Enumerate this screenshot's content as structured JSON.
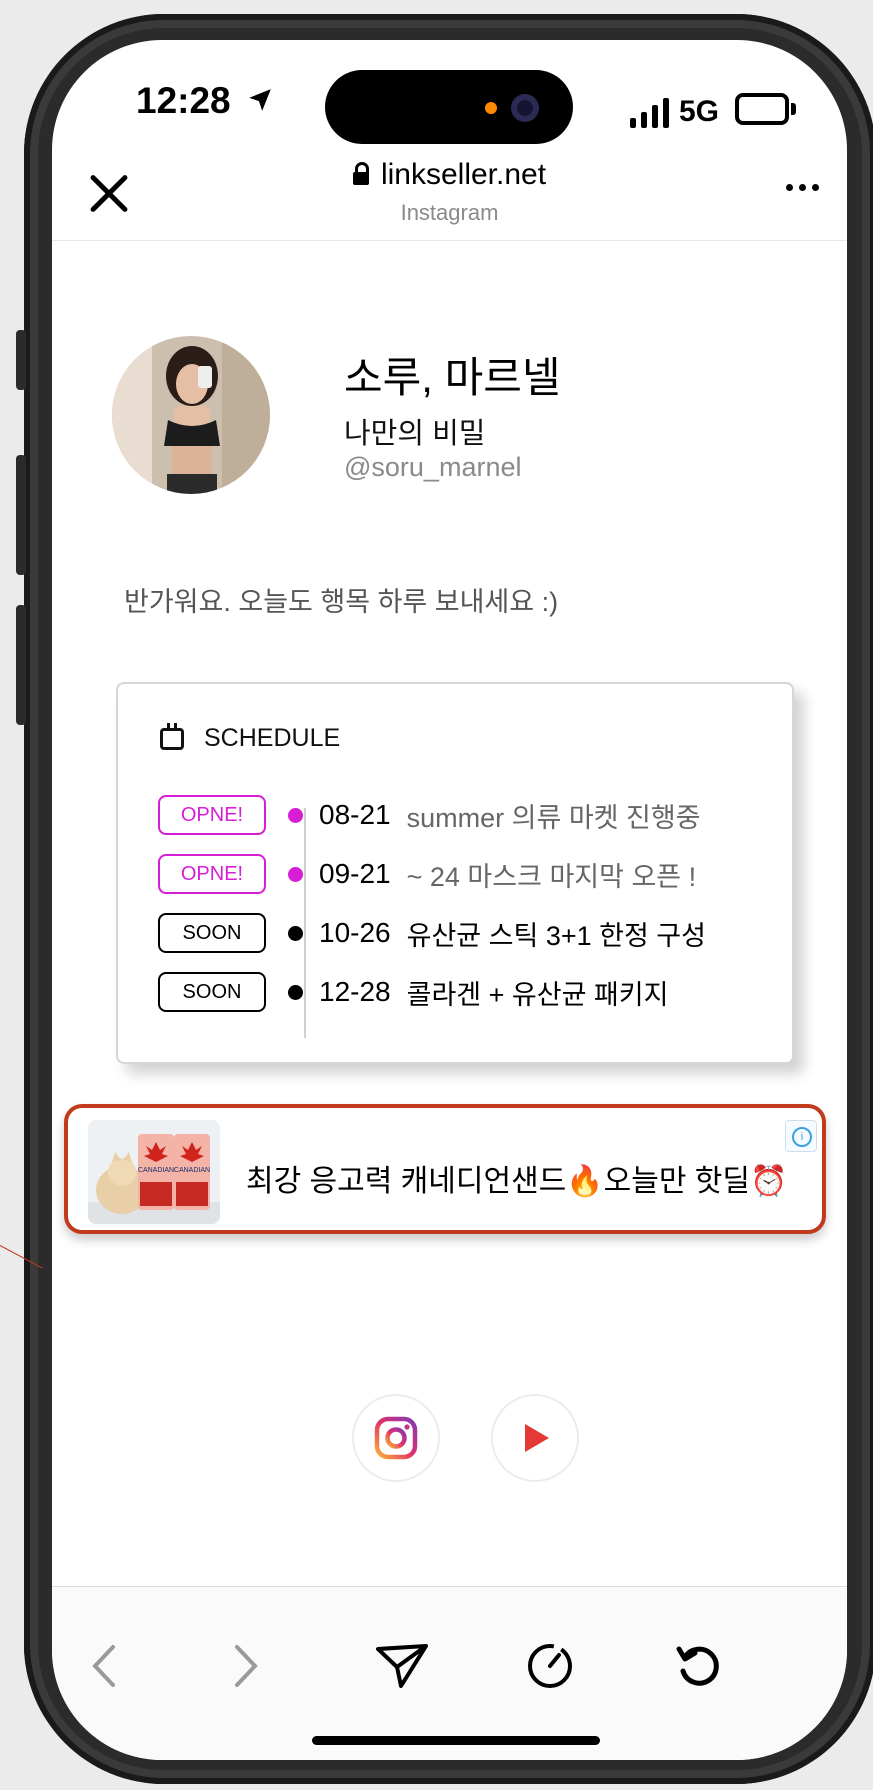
{
  "status": {
    "time": "12:28",
    "network": "5G"
  },
  "browser": {
    "url": "linkseller.net",
    "subtitle": "Instagram"
  },
  "profile": {
    "name": "소루, 마르넬",
    "tagline": "나만의 비밀",
    "handle": "@soru_marnel",
    "greeting": "반가워요. 오늘도 행목 하루 보내세요 :)"
  },
  "schedule": {
    "title": "SCHEDULE",
    "items": [
      {
        "badge": "OPNE!",
        "date": "08-21",
        "text": "summer 의류 마켓 진행중",
        "status": "open"
      },
      {
        "badge": "OPNE!",
        "date": "09-21",
        "text": "~ 24 마스크 마지막 오픈 !",
        "status": "open"
      },
      {
        "badge": "SOON",
        "date": "10-26",
        "text": "유산균 스틱 3+1 한정 구성",
        "status": "soon"
      },
      {
        "badge": "SOON",
        "date": "12-28",
        "text": "콜라겐 + 유산균 패키지",
        "status": "soon"
      }
    ]
  },
  "ad": {
    "text": "최강 응고력 캐네디언샌드🔥오늘만 핫딜⏰",
    "product_label": "CANADIAN"
  },
  "colors": {
    "accent": "#d61ed6",
    "ad_border": "#c23a1c",
    "youtube": "#e53935"
  }
}
